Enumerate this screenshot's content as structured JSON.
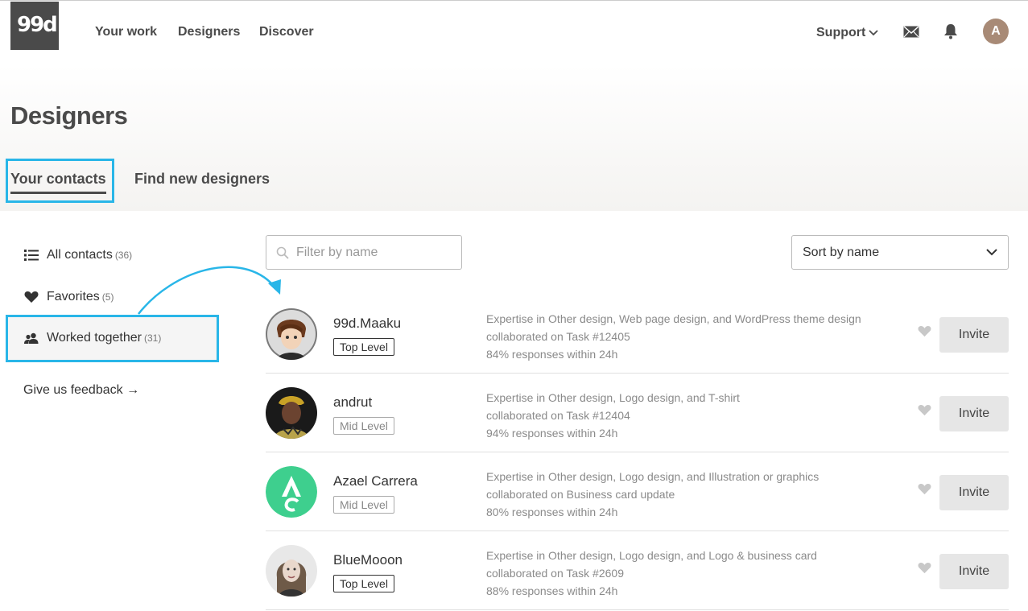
{
  "header": {
    "logo": "99d",
    "nav": [
      "Your work",
      "Designers",
      "Discover"
    ],
    "support": "Support",
    "avatar_initial": "A"
  },
  "page": {
    "title": "Designers",
    "tabs": [
      "Your contacts",
      "Find new designers"
    ],
    "active_tab": "Your contacts"
  },
  "sidebar": {
    "items": [
      {
        "label": "All contacts",
        "count": "(36)",
        "icon": "list-icon"
      },
      {
        "label": "Favorites",
        "count": "(5)",
        "icon": "heart-icon"
      },
      {
        "label": "Worked together",
        "count": "(31)",
        "icon": "people-icon"
      }
    ],
    "selected": "Worked together",
    "feedback": "Give us feedback →"
  },
  "filter": {
    "placeholder": "Filter by name"
  },
  "sort": {
    "value": "Sort by name"
  },
  "designers": [
    {
      "name": "99d.Maaku",
      "level": "Top Level",
      "expertise": "Expertise in Other design, Web page design, and WordPress theme design",
      "collab": "collaborated on Task #12405",
      "responses": "84% responses within 24h",
      "invite": "Invite"
    },
    {
      "name": "andrut",
      "level": "Mid Level",
      "expertise": "Expertise in Other design, Logo design, and T-shirt",
      "collab": "collaborated on Task #12404",
      "responses": "94% responses within 24h",
      "invite": "Invite"
    },
    {
      "name": "Azael Carrera",
      "level": "Mid Level",
      "expertise": "Expertise in Other design, Logo design, and Illustration or graphics",
      "collab": "collaborated on Business card update",
      "responses": "80% responses within 24h",
      "invite": "Invite"
    },
    {
      "name": "BlueMooon",
      "level": "Top Level",
      "expertise": "Expertise in Other design, Logo design, and Logo & business card",
      "collab": "collaborated on Task #2609",
      "responses": "88% responses within 24h",
      "invite": "Invite"
    }
  ],
  "colors": {
    "highlight": "#29b6e8",
    "text_dark": "#4a4a4a",
    "avatar_green": "#3ecf8e"
  }
}
